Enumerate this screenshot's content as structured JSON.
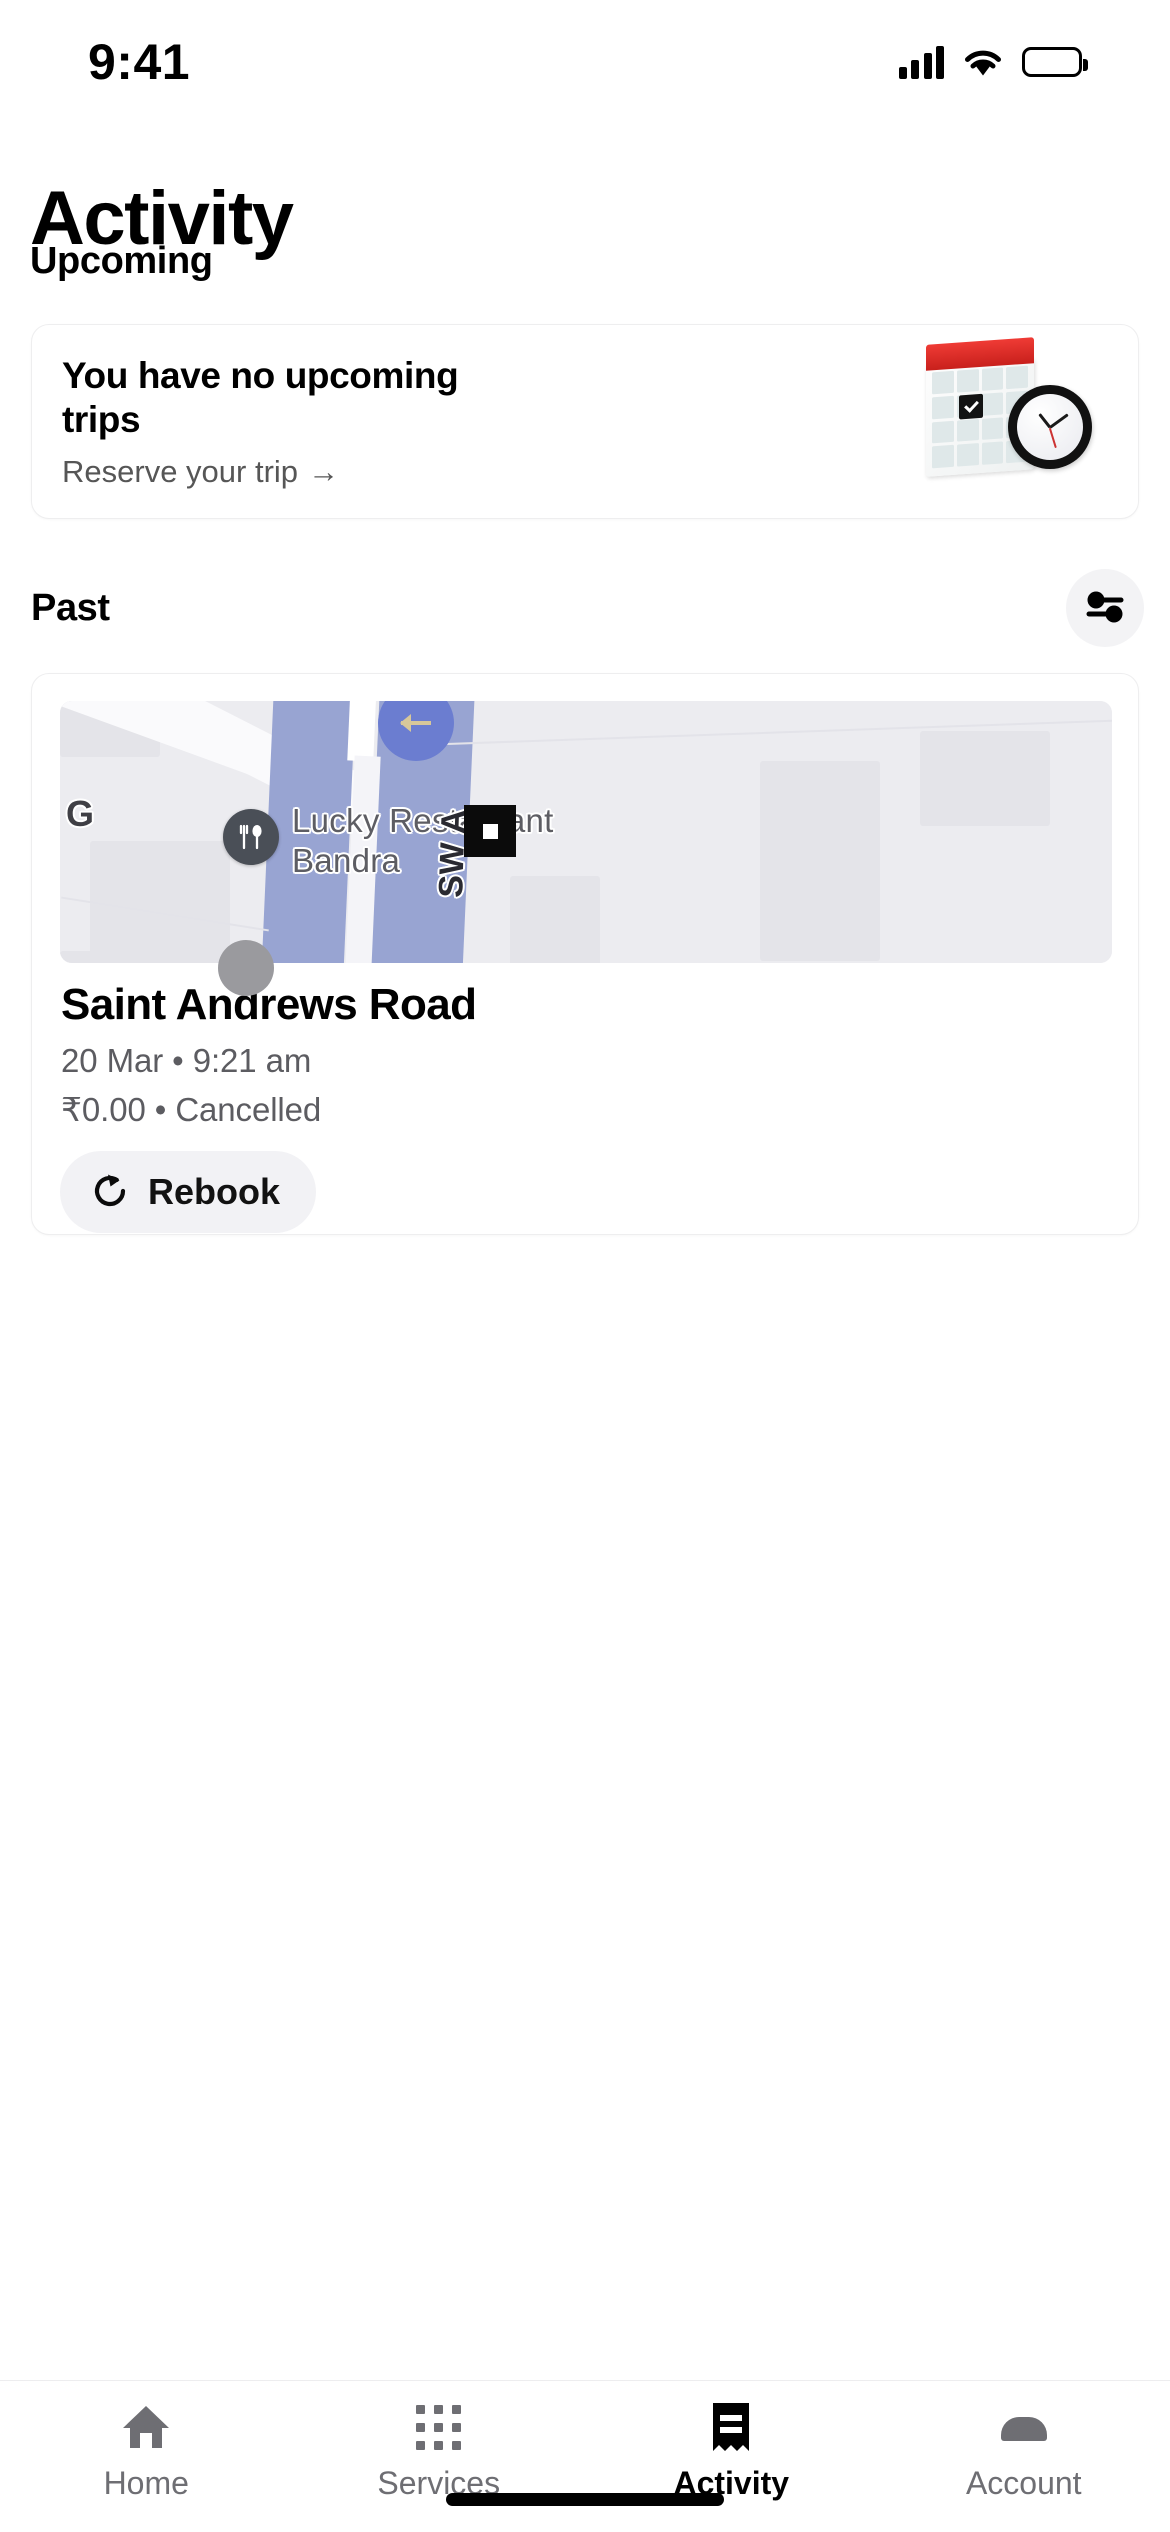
{
  "status_bar": {
    "time": "9:41",
    "cellular_icon": "cellular-signal-icon",
    "wifi_icon": "wifi-icon",
    "battery_icon": "battery-full-icon"
  },
  "header": {
    "title": "Activity"
  },
  "upcoming": {
    "section_title": "Upcoming",
    "card": {
      "headline": "You have no upcoming trips",
      "cta_label": "Reserve your trip",
      "cta_arrow": "→",
      "illustration": "calendar-clock-illustration"
    }
  },
  "past": {
    "section_title": "Past",
    "filter_button": {
      "icon": "filter-sliders-icon",
      "background": "#f3f3f5"
    },
    "trips": [
      {
        "map": {
          "poi_icon": "restaurant-fork-spoon-icon",
          "poi_label_line1": "Lucky Restaurant",
          "poi_label_line2": "Bandra",
          "street_label_left": "G",
          "street_label_rotated": "SW A",
          "destination_marker": "destination-square-marker",
          "pickup_marker": "pickup-dot-marker",
          "direction_marker": "direction-arrow-marker",
          "road_color": "#98a4d2",
          "land_color": "#ececf0"
        },
        "title": "Saint Andrews Road",
        "when": "20 Mar • 9:21 am",
        "fare_status": "₹0.00 • Cancelled",
        "rebook_label": "Rebook",
        "rebook_icon": "refresh-circular-arrow-icon"
      }
    ]
  },
  "tab_bar": {
    "items": [
      {
        "label": "Home",
        "icon": "home-icon",
        "active": false
      },
      {
        "label": "Services",
        "icon": "grid-apps-icon",
        "active": false
      },
      {
        "label": "Activity",
        "icon": "receipt-icon",
        "active": true
      },
      {
        "label": "Account",
        "icon": "person-icon",
        "active": false
      }
    ],
    "active_color": "#000000",
    "inactive_color": "#6e6e73"
  }
}
